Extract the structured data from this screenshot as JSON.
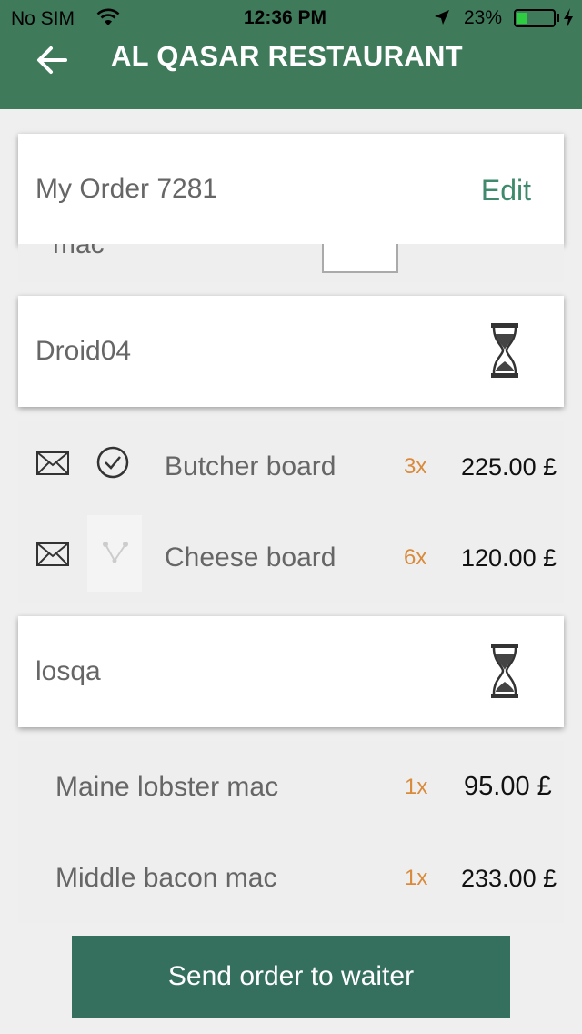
{
  "status_bar": {
    "carrier": "No SIM",
    "time": "12:36 PM",
    "battery": "23%"
  },
  "header": {
    "title": "AL QASAR RESTAURANT",
    "back_icon": "arrow-left-icon"
  },
  "order_card": {
    "title": "My Order 7281",
    "edit_label": "Edit"
  },
  "sections": [
    {
      "name": "Droid04",
      "status_icon": "hourglass-icon",
      "items": [
        {
          "name": "Butcher board",
          "qty": "3x",
          "price": "225.00 £",
          "icon": "envelope-icon",
          "status_icon": "check-circle-icon"
        },
        {
          "name": "Cheese board",
          "qty": "6x",
          "price": "120.00 £",
          "icon": "envelope-icon",
          "status_icon": "thumbnail-placeholder"
        }
      ]
    },
    {
      "name": "losqa",
      "status_icon": "hourglass-icon",
      "items": [
        {
          "name": "Maine lobster mac",
          "qty": "1x",
          "price": "95.00 £"
        },
        {
          "name": "Middle bacon mac",
          "qty": "1x",
          "price": "233.00 £"
        }
      ]
    }
  ],
  "actions": {
    "send_label": "Send order to waiter"
  },
  "colors": {
    "header": "#3f7a5b",
    "accent": "#3f8a6c",
    "qty": "#d98a3a",
    "button": "#356f5e"
  }
}
